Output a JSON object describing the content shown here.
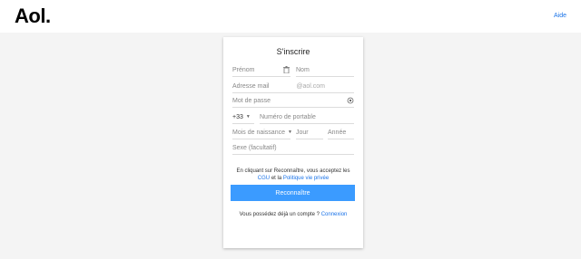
{
  "header": {
    "logo": "Aol.",
    "help_link": "Aide"
  },
  "form": {
    "title": "S'inscrire",
    "first_name_placeholder": "Prénom",
    "last_name_placeholder": "Nom",
    "email_placeholder": "Adresse mail",
    "email_domain": "@aol.com",
    "password_placeholder": "Mot de passe",
    "country_code": "+33",
    "phone_placeholder": "Numéro de portable",
    "birth_month_placeholder": "Mois de naissance",
    "birth_day_placeholder": "Jour",
    "birth_year_placeholder": "Année",
    "gender_placeholder": "Sexe (facultatif)",
    "terms_prefix": "En cliquant sur Reconnaître, vous acceptez les",
    "terms_link": "CGU",
    "terms_middle": "et la",
    "privacy_link": "Politique vie privée",
    "submit_label": "Reconnaître",
    "login_prompt": "Vous possédez déjà un compte ?",
    "login_link": "Connexion"
  },
  "icons": {
    "clear": "trash-icon",
    "show_password": "eye-icon",
    "dropdown": "chevron-down-icon"
  },
  "colors": {
    "accent": "#1a73e8",
    "button": "#3b9bff",
    "background": "#f4f4f4"
  }
}
